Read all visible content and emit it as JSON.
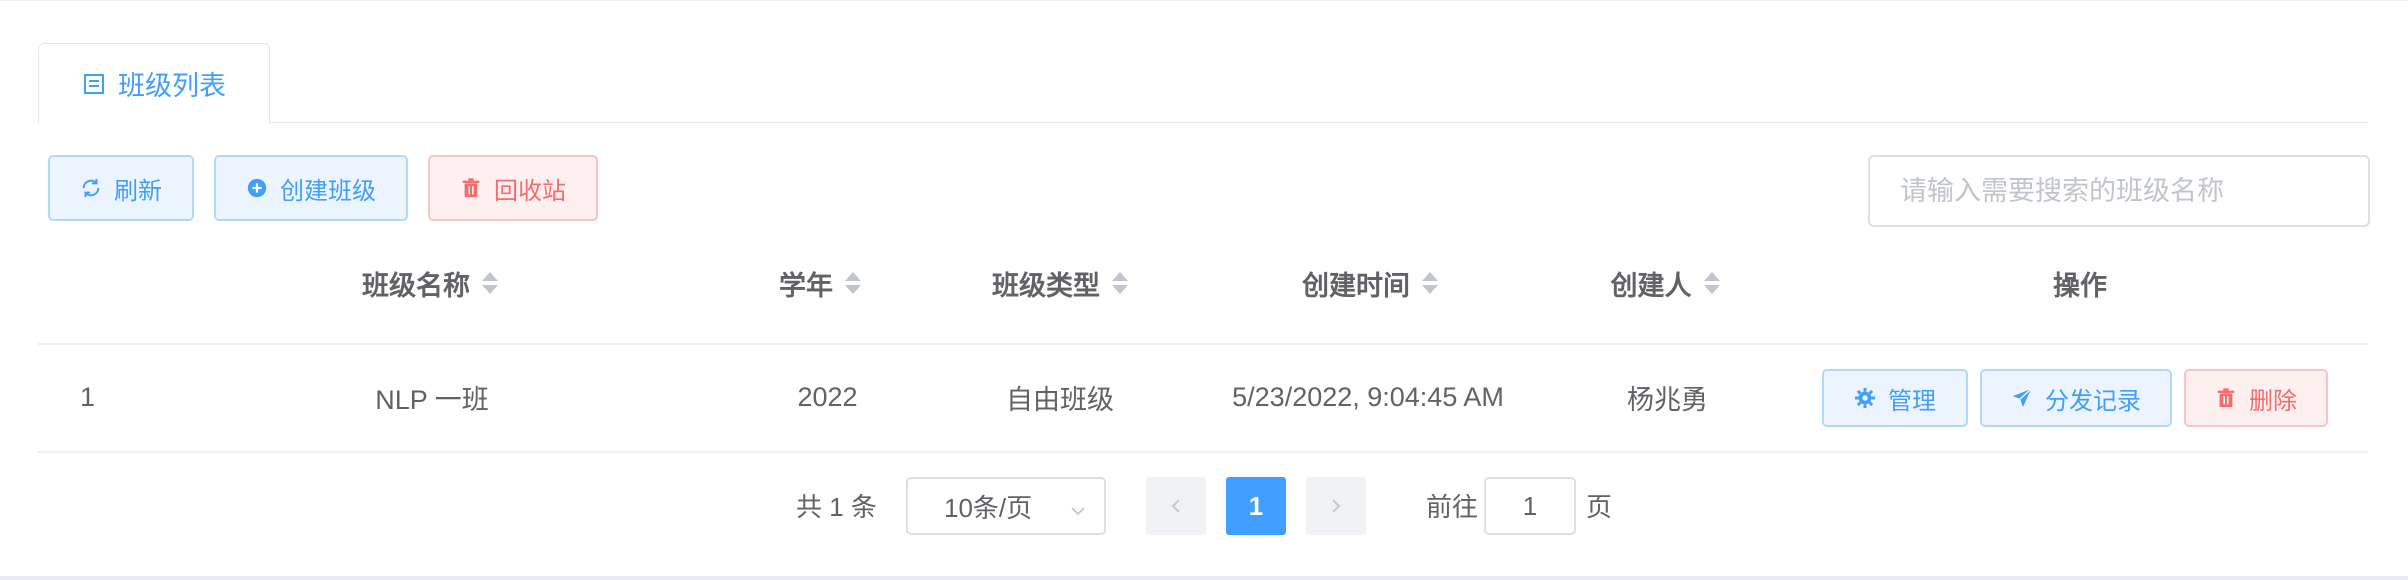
{
  "tabs": [
    {
      "label": "班级列表"
    }
  ],
  "toolbar": {
    "refresh_label": "刷新",
    "create_label": "创建班级",
    "recycle_label": "回收站"
  },
  "search": {
    "placeholder": "请输入需要搜索的班级名称",
    "value": ""
  },
  "table": {
    "columns": [
      "班级名称",
      "学年",
      "班级类型",
      "创建时间",
      "创建人",
      "操作"
    ],
    "rows": [
      {
        "index": "1",
        "name": "NLP 一班",
        "year": "2022",
        "type": "自由班级",
        "created_at": "5/23/2022, 9:04:45 AM",
        "creator": "杨兆勇",
        "actions": [
          "管理",
          "分发记录",
          "删除"
        ]
      }
    ]
  },
  "pagination": {
    "total_label": "共 1 条",
    "page_size": "10条/页",
    "current_page": "1",
    "goto_prefix": "前往",
    "goto_value": "1",
    "goto_suffix": "页"
  },
  "colors": {
    "primary": "#409eff",
    "danger": "#f56c6c"
  },
  "icons": {
    "tab": "list-icon",
    "refresh": "refresh-icon",
    "create": "plus-circle-icon",
    "recycle": "trash-icon",
    "manage": "gear-icon",
    "distribute": "send-icon",
    "delete": "trash-icon"
  }
}
